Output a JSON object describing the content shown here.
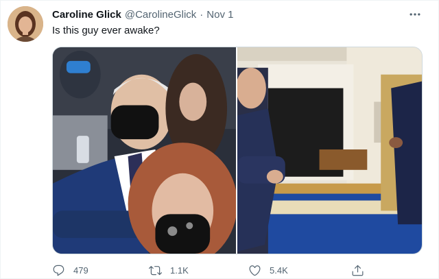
{
  "tweet": {
    "author_name": "Caroline Glick",
    "author_handle": "@CarolineGlick",
    "separator": "·",
    "date": "Nov 1",
    "text": "Is this guy ever awake?",
    "more_icon": "more-horizontal-icon"
  },
  "actions": {
    "reply_count": "479",
    "retweet_count": "1.1K",
    "like_count": "5.4K",
    "reply_icon": "reply-icon",
    "retweet_icon": "retweet-icon",
    "like_icon": "heart-icon",
    "share_icon": "share-icon"
  },
  "colors": {
    "text_primary": "#0f1419",
    "text_secondary": "#536471",
    "border": "#cfd9de"
  }
}
